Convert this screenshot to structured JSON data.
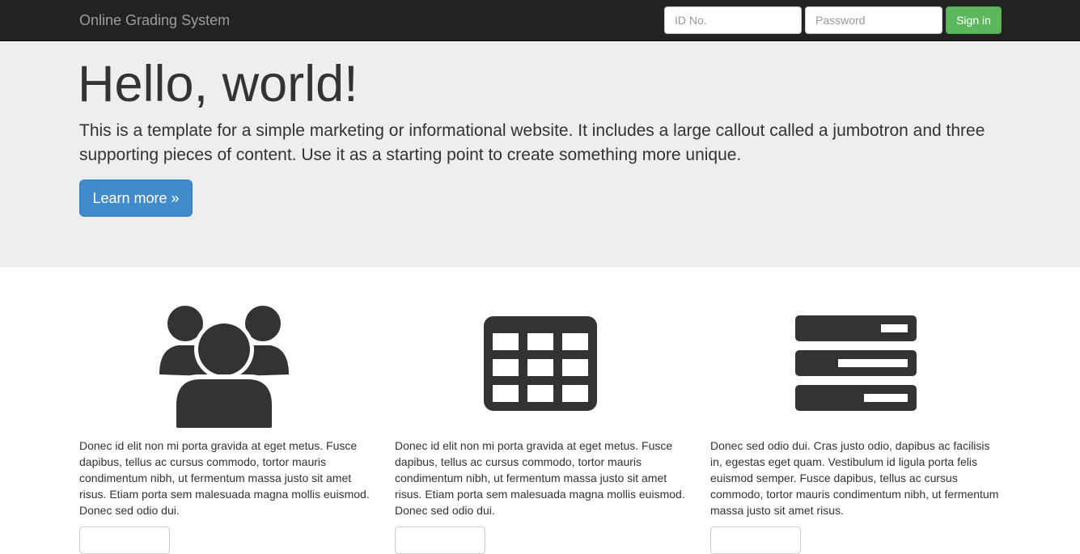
{
  "navbar": {
    "brand": "Online Grading System",
    "id_placeholder": "ID No.",
    "password_placeholder": "Password",
    "signin_label": "Sign in",
    "signin_color": "#5cb85c"
  },
  "jumbotron": {
    "title": "Hello, world!",
    "text": "This is a template for a simple marketing or informational website. It includes a large callout called a jumbotron and three supporting pieces of content. Use it as a starting point to create something more unique.",
    "button_label": "Learn more »",
    "button_color": "#428bca"
  },
  "columns": [
    {
      "icon": "users-group-icon",
      "text": "Donec id elit non mi porta gravida at eget metus. Fusce dapibus, tellus ac cursus commodo, tortor mauris condimentum nibh, ut fermentum massa justo sit amet risus. Etiam porta sem malesuada magna mollis euismod. Donec sed odio dui."
    },
    {
      "icon": "grid-table-icon",
      "text": "Donec id elit non mi porta gravida at eget metus. Fusce dapibus, tellus ac cursus commodo, tortor mauris condimentum nibh, ut fermentum massa justo sit amet risus. Etiam porta sem malesuada magna mollis euismod. Donec sed odio dui."
    },
    {
      "icon": "server-list-icon",
      "text": "Donec sed odio dui. Cras justo odio, dapibus ac facilisis in, egestas eget quam. Vestibulum id ligula porta felis euismod semper. Fusce dapibus, tellus ac cursus commodo, tortor mauris condimentum nibh, ut fermentum massa justo sit amet risus."
    }
  ]
}
